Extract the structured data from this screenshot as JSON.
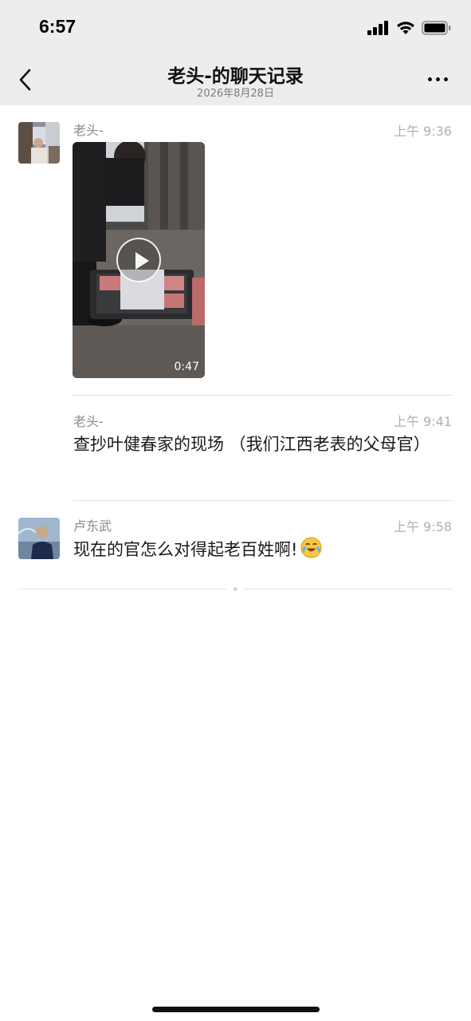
{
  "status_bar": {
    "time": "6:57",
    "icons": [
      "cellular-signal-icon",
      "wifi-icon",
      "battery-icon"
    ]
  },
  "nav": {
    "title": "老头-的聊天记录",
    "subtitle": "2026年8月28日",
    "back_icon": "chevron-left-icon",
    "more_icon": "more-dots-icon"
  },
  "messages": [
    {
      "sender": "老头-",
      "time": "上午 9:36",
      "type": "video",
      "video_duration": "0:47"
    },
    {
      "sender": "老头-",
      "time": "上午 9:41",
      "type": "text",
      "text": "查抄叶健春家的现场 （我们江西老表的父母官）"
    },
    {
      "sender": "卢东武",
      "time": "上午 9:58",
      "type": "text",
      "text": "现在的官怎么对得起老百姓啊!",
      "emoji": "crying-laughing-emoji"
    }
  ],
  "colors": {
    "header_bg": "#ededed",
    "page_bg": "#ffffff",
    "meta_text": "#8a8a8a"
  }
}
